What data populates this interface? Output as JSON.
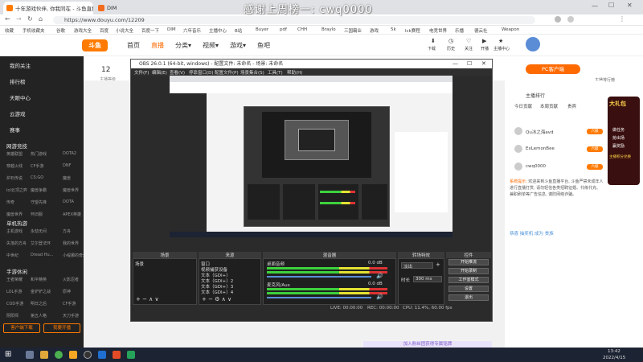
{
  "browser": {
    "tabs": [
      {
        "label": "十年游戏伙伴, 你我同在 - 斗鱼直播"
      },
      {
        "label": "DIM"
      }
    ],
    "url": "https://www.douyu.com/12209",
    "bookmarks": [
      "收藏",
      "手机收藏夹",
      "谷歌",
      "游戏大全",
      "百度",
      "小说大全",
      "百度一下",
      "DIM",
      "六年音乐",
      "主播中心",
      "B站",
      "Buyer",
      "pdf",
      "CHH",
      "Braylo",
      "三国霸业",
      "游戏",
      "5k",
      "lck赛程",
      "电竞世界",
      "乐播",
      "德云社",
      "Weapon"
    ]
  },
  "overlay_text": "感谢上周榜一: cwq0000",
  "site": {
    "logo": "斗鱼",
    "nav": [
      "首页",
      "直播",
      "分类▾",
      "视频▾",
      "游戏▾",
      "鱼吧"
    ],
    "user_icons": [
      "下载",
      "历史",
      "关注",
      "开播",
      "主播中心"
    ],
    "room_number": "12",
    "room_label": "主播等级",
    "pc_client_btn": "PC客户端",
    "pc_client_sub": "主播排行榜"
  },
  "sidebar": {
    "items": [
      "我的关注",
      "排行榜",
      "天眼中心",
      "云游戏",
      "赛事"
    ],
    "section_hot": "网游竞技",
    "hot_grid": [
      [
        "英雄联盟",
        "热门游戏",
        "DOTA2"
      ],
      [
        "穿越火线",
        "CF手游",
        "DNF"
      ],
      [
        "炉石传说",
        "CS:GO",
        "魔兽"
      ],
      [
        "lol云顶之弈",
        "魔兽争霸",
        "魔兽世界"
      ],
      [
        "传奇",
        "守望先锋",
        "DOTA"
      ],
      [
        "魔兽世界",
        "怀旧服",
        "APEX英雄"
      ]
    ],
    "section_mobile": "单机热游",
    "mobile_grid": [
      [
        "主机游戏",
        "永劫无间",
        "方舟"
      ],
      [
        "失落的方舟",
        "艾尔登法环",
        "我的世界"
      ],
      [
        "中世纪",
        "Dread Hu...",
        "小缇娜的奇幻之地"
      ]
    ],
    "section_phone": "手游休闲",
    "phone_grid": [
      [
        "王者荣耀",
        "和平精英",
        "火影忍者"
      ],
      [
        "LOL手游",
        "金铲铲之战",
        "原神"
      ],
      [
        "COD手游",
        "明日之后",
        "CF手游"
      ],
      [
        "阴阳师",
        "第五人格",
        "天刀手游"
      ]
    ],
    "btn_left": "客户端下载",
    "btn_right": "我要开播"
  },
  "obs": {
    "title": "OBS 26.0.1 (64-bit, windows) - 配置文件: 未命名 - 场景: 未命名",
    "menu": [
      "文件(F)",
      "编辑(E)",
      "查看(V)",
      "停靠窗口(D)",
      "配置文件(P)",
      "场景集合(S)",
      "工具(T)",
      "帮助(H)"
    ],
    "docks": {
      "scenes": {
        "title": "场景",
        "items": [
          "场景"
        ]
      },
      "sources": {
        "title": "来源",
        "items": [
          "窗口",
          "视频捕获设备",
          "文本（GDI+）",
          "文本（GDI+）2",
          "文本（GDI+）3",
          "文本（GDI+）4"
        ]
      },
      "mixer": {
        "title": "混音器",
        "channels": [
          "桌面音频",
          "麦克风/Aux"
        ],
        "db_top": "0.0 dB",
        "db_bottom": "0.0 dB"
      },
      "transitions": {
        "title": "转场特效",
        "mode": "淡出",
        "duration_label": "时长",
        "duration": "300 ms"
      },
      "controls": {
        "title": "控件",
        "buttons": [
          "开始推流",
          "开始录制",
          "工作室模式",
          "设置",
          "退出"
        ]
      }
    },
    "status": {
      "live": "LIVE: 00:00:00",
      "rec": "REC: 00:00:00",
      "cpu": "CPU: 11.4%, 60.00 fps"
    }
  },
  "rightpanel": {
    "tabs": [
      "今日贡献",
      "本周贡献",
      "贵宾"
    ],
    "header": "主播排行",
    "users": [
      "Qu冰之海avd",
      "ExLemonBee",
      "cwq0000"
    ],
    "badges": [
      "六级",
      "六级",
      "六级"
    ],
    "notice_label": "系统提示:",
    "notice": "欢迎来到斗鱼直播平台, 斗鱼严禁未成年人进行直播打赏, 请勿轻信各类招聘征婚、代练代充、兼职刷单等广告信息, 谨防网络诈骗。",
    "chat": "恭喜 抽奖机 成为 贵族",
    "promo": [
      "做任务",
      "抢出场",
      "赢奖励"
    ],
    "promo_title": "大礼包",
    "promo_btn": "主播积分兑换"
  },
  "bottom_banner": "加入粉丝团获得专属铭牌",
  "taskbar": {
    "time": "13:42",
    "date": "2022/4/15"
  }
}
